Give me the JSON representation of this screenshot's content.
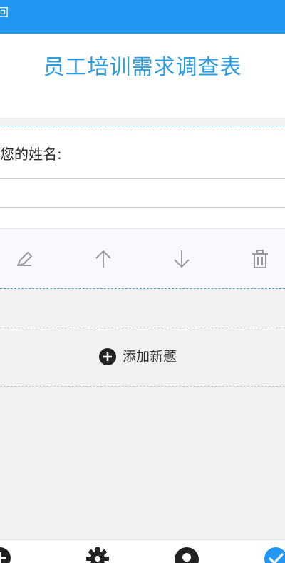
{
  "header": {
    "back_label": "回"
  },
  "survey": {
    "title": "员工培训需求调查表"
  },
  "question": {
    "label": "您的姓名:"
  },
  "toolbar": {
    "edit_icon": "pencil-edit-icon",
    "move_up_icon": "arrow-up-icon",
    "move_down_icon": "arrow-down-icon",
    "delete_icon": "trash-icon"
  },
  "add_question": {
    "label": "添加新题",
    "icon": "plus-circle-icon"
  },
  "bottom_nav": {
    "icons": [
      "plus-circle-icon",
      "gear-icon",
      "user-icon",
      "check-circle-icon"
    ]
  },
  "colors": {
    "topbar": "#2196f3",
    "title": "#2a9de6",
    "accent_border": "#39a6d8",
    "text": "#2b2b2b"
  }
}
